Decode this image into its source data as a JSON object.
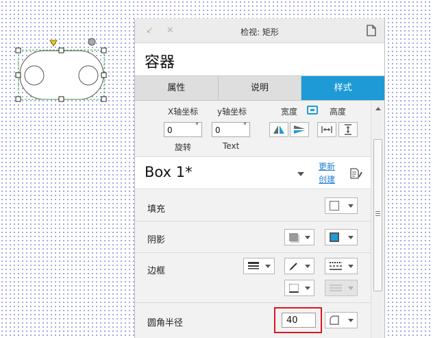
{
  "panel": {
    "title": "检视: 矩形",
    "widget_name": "容器",
    "tabs": [
      {
        "label": "属性",
        "active": false
      },
      {
        "label": "说明",
        "active": false
      },
      {
        "label": "样式",
        "active": true
      }
    ]
  },
  "geometry": {
    "x_label": "X轴坐标",
    "y_label": "y轴坐标",
    "width_label": "宽度",
    "height_label": "高度",
    "rotation_value": "0",
    "text_rotation_value": "0",
    "degree_symbol": "°",
    "rotation_label": "旋转",
    "text_label": "Text"
  },
  "style": {
    "name": "Box 1*",
    "update_link": "更新",
    "create_link": "创建"
  },
  "properties": {
    "fill_label": "填充",
    "shadow_label": "阴影",
    "border_label": "边框",
    "corner_radius_label": "圆角半径",
    "corner_radius_value": "40"
  },
  "colors": {
    "accent": "#1e9bd7",
    "highlight": "#e0141e",
    "selection": "#2fb52f",
    "handle_marker": "#f2c81c"
  }
}
